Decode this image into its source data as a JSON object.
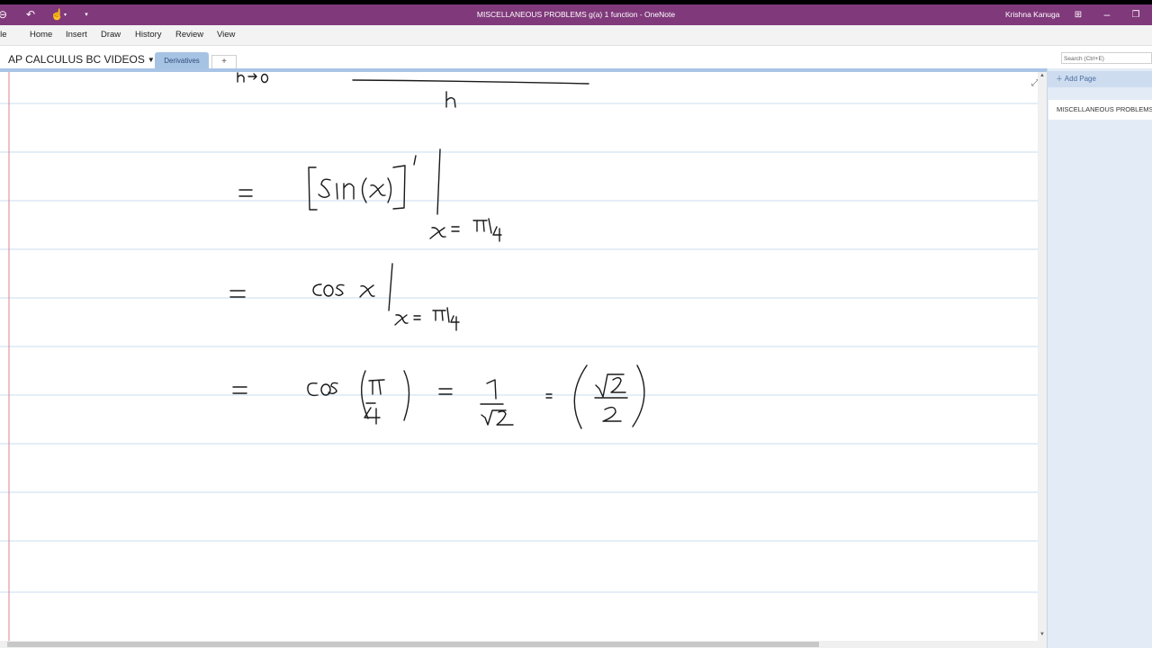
{
  "title_bar": {
    "title": "MISCELLANEOUS PROBLEMS    g(a) 1 function  -  OneNote",
    "user": "Krishna Kanuga"
  },
  "ribbon": {
    "tabs": [
      "ile",
      "Home",
      "Insert",
      "Draw",
      "History",
      "Review",
      "View"
    ]
  },
  "notebook": {
    "name": "AP CALCULUS BC VIDEOS",
    "section_tab": "Derivatives",
    "add_tab": "+"
  },
  "search": {
    "placeholder": "Search (Ctrl+E)"
  },
  "pages_pane": {
    "add_page_label": "Add Page",
    "pages": [
      "MISCELLANEOUS PROBLEMS"
    ]
  },
  "colors": {
    "title_bar": "#80397b",
    "section_tab": "#a7c3e4",
    "rule_line": "#c9ddef",
    "margin_line": "#d9838f",
    "ink": "#1a1a1a"
  }
}
